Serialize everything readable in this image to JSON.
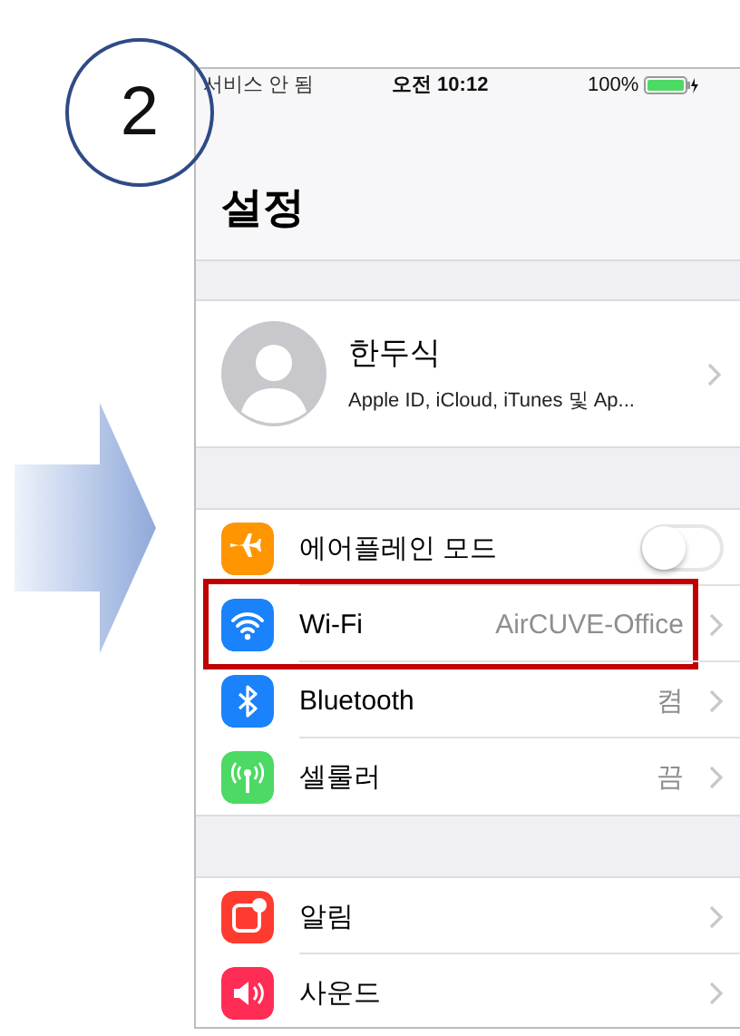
{
  "step": {
    "number": "2"
  },
  "status_bar": {
    "carrier": "서비스 안 됨",
    "time": "오전 10:12",
    "battery": "100%"
  },
  "title": "설정",
  "profile": {
    "name": "한두식",
    "subtitle": "Apple ID, iCloud, iTunes 및 Ap..."
  },
  "groups": [
    {
      "rows": [
        {
          "kind": "toggle",
          "label": "에어플레인 모드",
          "on": false,
          "highlighted": false,
          "color": "#ff9500"
        },
        {
          "kind": "link",
          "label": "Wi-Fi",
          "value": "AirCUVE-Office",
          "highlighted": true,
          "color": "#1a82fb"
        },
        {
          "kind": "link",
          "label": "Bluetooth",
          "value": "켬",
          "highlighted": false,
          "color": "#1a82fb"
        },
        {
          "kind": "link",
          "label": "셀룰러",
          "value": "끔",
          "highlighted": false,
          "color": "#4cd964"
        }
      ]
    },
    {
      "rows": [
        {
          "kind": "link",
          "label": "알림",
          "highlighted": false,
          "color": "#ff3b30"
        },
        {
          "kind": "link",
          "label": "사운드",
          "highlighted": false,
          "color": "#ff2d55"
        }
      ]
    }
  ]
}
